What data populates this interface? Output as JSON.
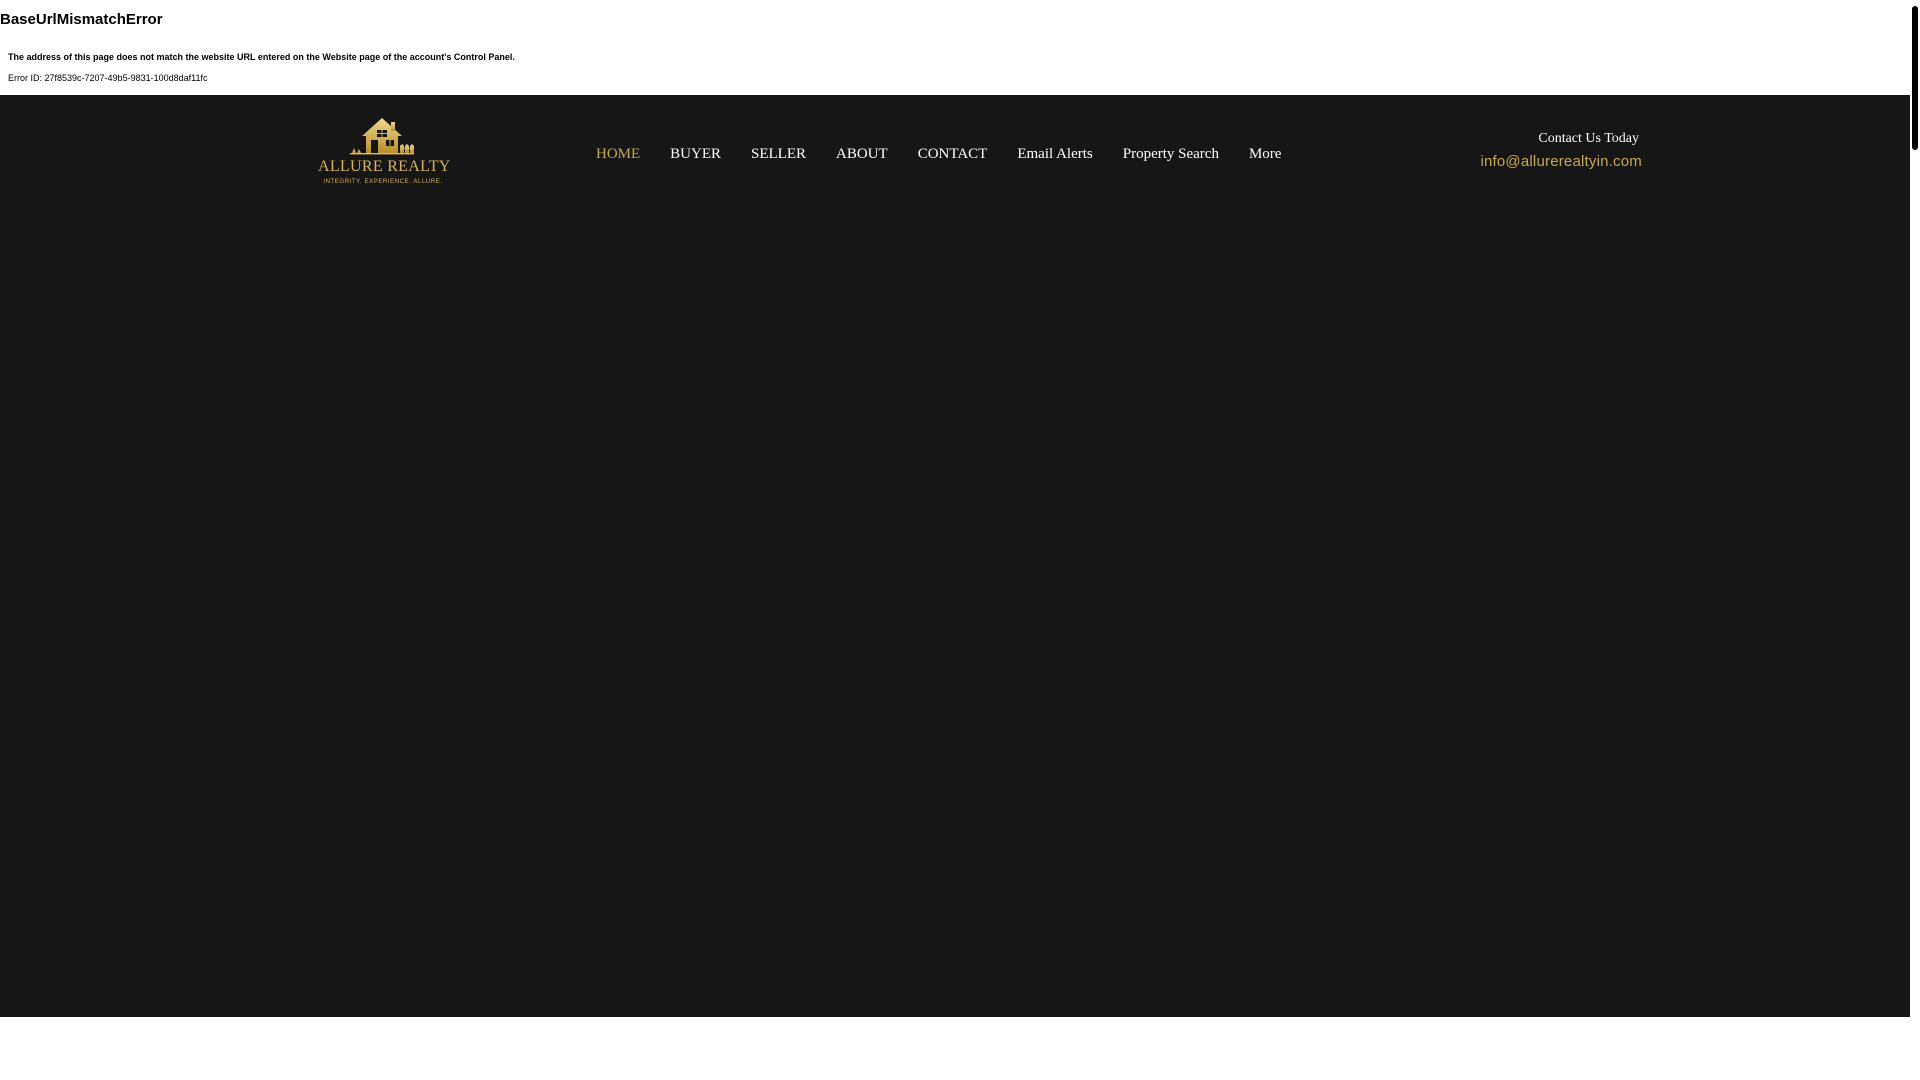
{
  "error": {
    "title": "BaseUrlMismatchError",
    "message": "The address of this page does not match the website URL entered on the Website page of the account's Control Panel.",
    "error_id": "Error ID: 27f8539c-7207-49b5-9831-100d8daf11fc"
  },
  "header": {
    "logo": {
      "name": "ALLURE REALTY",
      "tagline": "INTEGRITY. EXPERIENCE. ALLURE.",
      "icon": "house-icon"
    },
    "nav": [
      {
        "label": "HOME",
        "active": true
      },
      {
        "label": "BUYER"
      },
      {
        "label": "SELLER"
      },
      {
        "label": "ABOUT"
      },
      {
        "label": "CONTACT"
      },
      {
        "label": "Email Alerts"
      },
      {
        "label": "Property Search"
      },
      {
        "label": "More"
      }
    ],
    "contact": {
      "heading": "Contact Us Today",
      "email": "info@allurerealtyin.com"
    }
  },
  "colors": {
    "background": "#161616",
    "accent_gold": "#c9a94e",
    "nav_text": "#ffffff"
  }
}
